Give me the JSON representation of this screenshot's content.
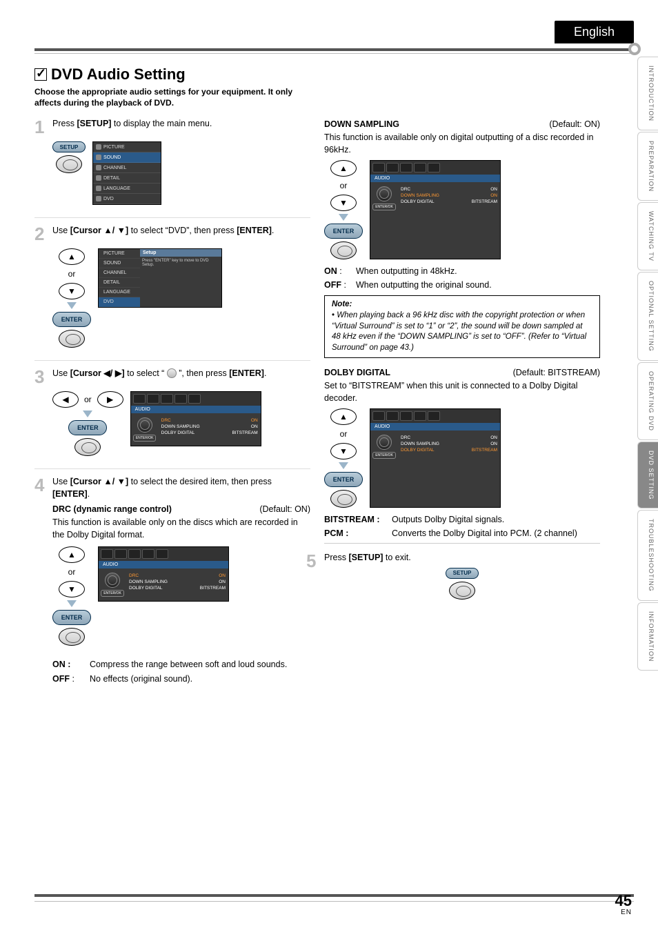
{
  "header": {
    "language": "English"
  },
  "tabs": [
    "INTRODUCTION",
    "PREPARATION",
    "WATCHING  TV",
    "OPTIONAL  SETTING",
    "OPERATING  DVD",
    "DVD  SETTING",
    "TROUBLESHOOTING",
    "INFORMATION"
  ],
  "active_tab_index": 5,
  "title": "DVD Audio Setting",
  "subtitle": "Choose the appropriate audio settings for your equipment. It only affects during the playback of DVD.",
  "steps": {
    "s1": {
      "num": "1",
      "pre": "Press ",
      "key": "[SETUP]",
      "post": " to display the main menu."
    },
    "s2": {
      "num": "2",
      "pre": "Use ",
      "key": "[Cursor ▲/ ▼]",
      "mid": " to select “DVD”, then press ",
      "key2": "[ENTER]",
      "post": "."
    },
    "s3": {
      "num": "3",
      "pre": "Use ",
      "key": "[Cursor ◀/ ▶]",
      "mid": " to select “ ",
      "post": " ”, then press ",
      "key2": "[ENTER]",
      "post2": "."
    },
    "s4": {
      "num": "4",
      "pre": "Use ",
      "key": "[Cursor ▲/ ▼]",
      "mid": " to select the desired item, then press ",
      "key2": "[ENTER]",
      "post": "."
    },
    "s5": {
      "num": "5",
      "pre": "Press ",
      "key": "[SETUP]",
      "post": " to exit."
    }
  },
  "setup_label": "SETUP",
  "enter_label": "ENTER",
  "or_label": "or",
  "osd_menu1": [
    "PICTURE",
    "SOUND",
    "CHANNEL",
    "DETAIL",
    "LANGUAGE",
    "DVD"
  ],
  "osd_menu1_sel": 1,
  "osd_menu2_sel": 5,
  "osd_wide": {
    "hdr": "Setup",
    "msg": "Press \"ENTER\" key to move to DVD Setup."
  },
  "osd_audio": {
    "bar": "AUDIO",
    "ok": "ENTER/OK",
    "rows": [
      {
        "k": "DRC",
        "v": "ON"
      },
      {
        "k": "DOWN SAMPLING",
        "v": "ON"
      },
      {
        "k": "DOLBY DIGITAL",
        "v": "BITSTREAM"
      }
    ]
  },
  "drc": {
    "name": "DRC (dynamic range control)",
    "default": "(Default: ON)",
    "desc": "This function is available only on the discs which are recorded in the Dolby Digital format.",
    "on_lbl": "ON :",
    "on_txt": "Compress the range between soft and loud sounds.",
    "off_lbl": "OFF",
    "off_colon": " : ",
    "off_txt": "No effects (original sound)."
  },
  "down": {
    "name": "DOWN SAMPLING",
    "default": "(Default: ON)",
    "desc": "This function is available only on digital outputting of a disc recorded in 96kHz.",
    "on_lbl": "ON",
    "on_colon": " :   ",
    "on_txt": "When outputting in 48kHz.",
    "off_lbl": "OFF",
    "off_colon": " : ",
    "off_txt": "When outputting the original sound."
  },
  "note": {
    "hdr": "Note:",
    "body": "When playing back a 96 kHz disc with the copyright protection or when “Virtual Surround” is set to “1” or “2”, the sound will be down sampled at 48 kHz even if the “DOWN SAMPLING” is set to “OFF”. (Refer to “Virtual Surround” on page 43.)"
  },
  "dolby": {
    "name": "DOLBY DIGITAL",
    "default": "(Default: BITSTREAM)",
    "desc": "Set to “BITSTREAM” when this unit is connected to a Dolby Digital decoder.",
    "bit_lbl": "BITSTREAM :",
    "bit_txt": "Outputs Dolby Digital signals.",
    "pcm_lbl": "PCM :",
    "pcm_txt": "Converts the Dolby Digital into PCM. (2 channel)"
  },
  "page": {
    "num": "45",
    "region": "EN"
  }
}
